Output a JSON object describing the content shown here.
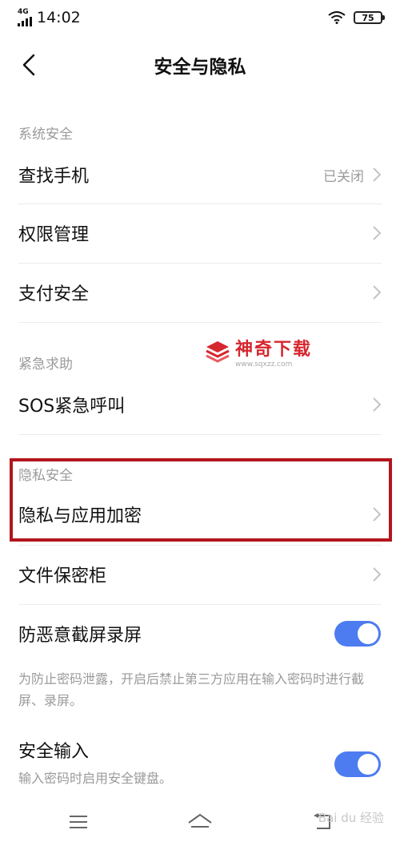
{
  "status_bar": {
    "network": "4G",
    "time": "14:02",
    "battery": "75"
  },
  "header": {
    "title": "安全与隐私"
  },
  "sections": [
    {
      "label": "系统安全",
      "items": [
        {
          "label": "查找手机",
          "value": "已关闭"
        },
        {
          "label": "权限管理"
        },
        {
          "label": "支付安全"
        }
      ]
    },
    {
      "label": "紧急求助",
      "items": [
        {
          "label": "SOS紧急呼叫"
        }
      ]
    },
    {
      "label": "隐私安全",
      "items": [
        {
          "label": "隐私与应用加密"
        },
        {
          "label": "文件保密柜"
        },
        {
          "label": "防恶意截屏录屏",
          "toggle": true,
          "description": "为防止密码泄露，开启后禁止第三方应用在输入密码时进行截屏、录屏。"
        },
        {
          "label": "安全输入",
          "toggle": true,
          "description": "输入密码时启用安全键盘。"
        }
      ]
    }
  ],
  "watermark": {
    "name": "神奇下载",
    "url": "www.sqxzz.com"
  },
  "baidu_watermark": "Bai du 经验",
  "colors": {
    "accent": "#4c7cf0",
    "highlight": "#b3151c",
    "secondary_text": "#9a9a9a"
  },
  "icons": [
    "signal-icon",
    "wifi-icon",
    "battery-icon",
    "back-arrow-icon",
    "chevron-right-icon",
    "menu-icon",
    "home-icon",
    "back-nav-icon"
  ]
}
